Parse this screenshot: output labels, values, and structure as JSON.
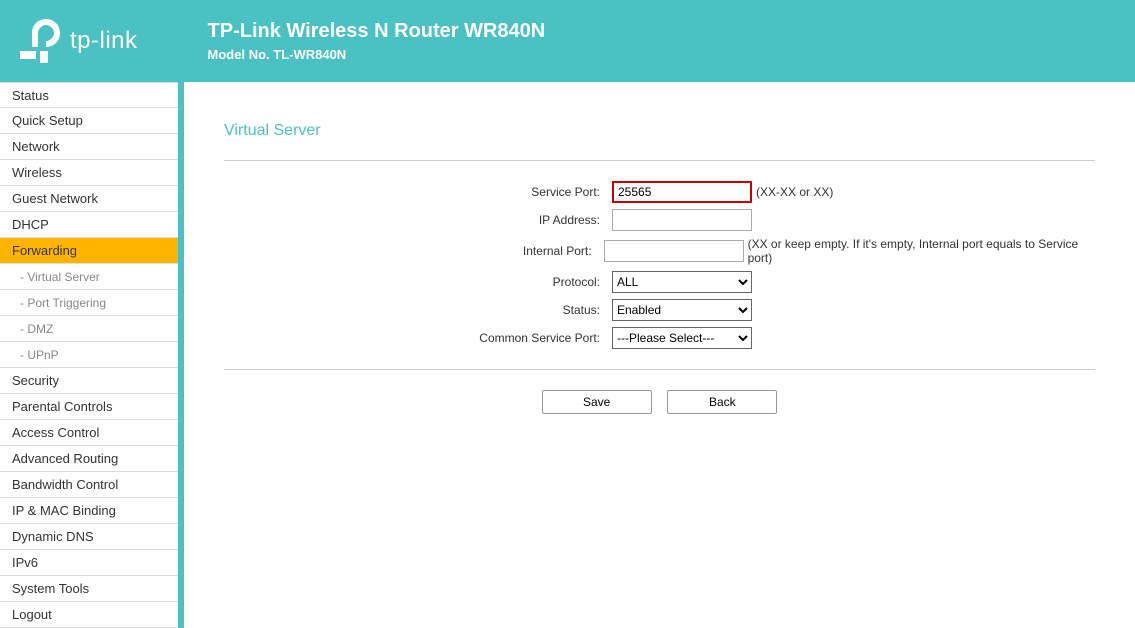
{
  "header": {
    "brand": "tp-link",
    "title": "TP-Link Wireless N Router WR840N",
    "subtitle": "Model No. TL-WR840N"
  },
  "sidebar": {
    "items": [
      {
        "label": "Status"
      },
      {
        "label": "Quick Setup"
      },
      {
        "label": "Network"
      },
      {
        "label": "Wireless"
      },
      {
        "label": "Guest Network"
      },
      {
        "label": "DHCP"
      },
      {
        "label": "Forwarding",
        "active": true
      },
      {
        "label": "Security"
      },
      {
        "label": "Parental Controls"
      },
      {
        "label": "Access Control"
      },
      {
        "label": "Advanced Routing"
      },
      {
        "label": "Bandwidth Control"
      },
      {
        "label": "IP & MAC Binding"
      },
      {
        "label": "Dynamic DNS"
      },
      {
        "label": "IPv6"
      },
      {
        "label": "System Tools"
      },
      {
        "label": "Logout"
      }
    ],
    "subitems": [
      {
        "label": "- Virtual Server"
      },
      {
        "label": "- Port Triggering"
      },
      {
        "label": "- DMZ"
      },
      {
        "label": "- UPnP"
      }
    ]
  },
  "page": {
    "title": "Virtual Server",
    "form": {
      "service_port": {
        "label": "Service Port:",
        "value": "25565",
        "hint": "(XX-XX or XX)"
      },
      "ip_address": {
        "label": "IP Address:",
        "value": ""
      },
      "internal_port": {
        "label": "Internal Port:",
        "value": "",
        "hint": "(XX or keep empty. If it's empty, Internal port equals to Service port)"
      },
      "protocol": {
        "label": "Protocol:",
        "value": "ALL",
        "options": [
          "ALL"
        ]
      },
      "status": {
        "label": "Status:",
        "value": "Enabled",
        "options": [
          "Enabled"
        ]
      },
      "common_service_port": {
        "label": "Common Service Port:",
        "value": "---Please Select---",
        "options": [
          "---Please Select---"
        ]
      }
    },
    "buttons": {
      "save": "Save",
      "back": "Back"
    }
  }
}
